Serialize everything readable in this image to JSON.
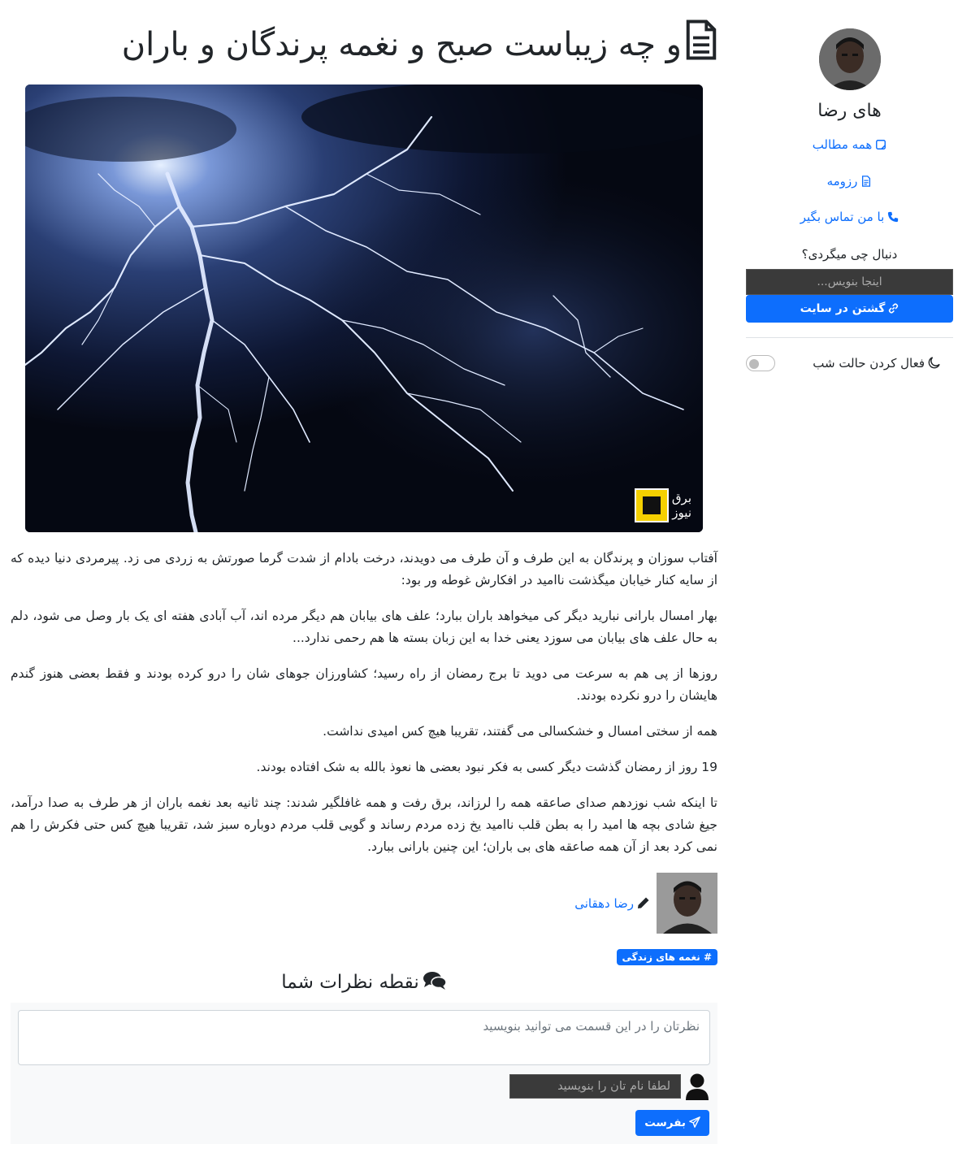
{
  "sidebar": {
    "site_name": "های رضا",
    "nav": [
      {
        "label": "همه مطالب",
        "icon": "bookmark-icon"
      },
      {
        "label": "رزومه",
        "icon": "document-icon"
      },
      {
        "label": "با من تماس بگیر",
        "icon": "phone-icon"
      }
    ],
    "search": {
      "label": "دنبال چی میگردی؟",
      "placeholder": "اینجا بنویس...",
      "button_label": "گشتن در سایت"
    },
    "dark_mode": {
      "label": "فعال کردن حالت شب",
      "enabled": false
    }
  },
  "post": {
    "title": "و چه زیباست صبح و نغمه پرندگان و باران",
    "image_logo_text": [
      "برق",
      "نیوز"
    ],
    "paragraphs": [
      "آفتاب سوزان و پرندگان به این طرف و آن طرف می دویدند، درخت بادام از شدت گرما صورتش به زردی می زد. پیرمردی دنیا دیده که از سایه کنار خیابان میگذشت ناامید در افکارش غوطه ور بود:",
      "بهار امسال بارانی نبارید دیگر کی میخواهد باران ببارد؛ علف های بیابان هم دیگر مرده اند، آب آبادی هفته ای یک بار وصل می شود، دلم به حال علف های بیابان می سوزد یعنی خدا به این زبان بسته ها هم رحمی ندارد...",
      "روزها از پی هم به سرعت می دوید تا برج رمضان از راه رسید؛ کشاورزان جوهای شان را درو کرده بودند و فقط بعضی هنوز گندم هایشان را درو نکرده بودند.",
      "همه از سختی امسال و خشکسالی می گفتند، تقریبا هیچ کس امیدی نداشت.",
      "19 روز از رمضان گذشت دیگر کسی به فکر نبود بعضی ها نعوذ بالله به شک افتاده بودند.",
      "تا اینکه شب نوزدهم صدای صاعقه همه را لرزاند، برق رفت و همه غافلگیر شدند: چند ثانیه بعد نغمه باران از هر طرف به صدا درآمد، جیغ شادی بچه ها امید را به بطن قلب ناامید یخ زده مردم رساند و گویی قلب مردم دوباره سبز شد، تقریبا هیچ کس حتی فکرش را هم نمی کرد بعد از آن همه صاعقه های بی باران؛ این چنین بارانی ببارد."
    ],
    "author": "رضا دهقانی",
    "tag": "# نغمه های زندگی"
  },
  "comments": {
    "title": "نقطه نظرات شما",
    "textarea_placeholder": "نظرتان را در این قسمت می توانید بنویسید",
    "name_placeholder": "لطفا نام تان را بنویسید",
    "send_label": "بفرست"
  },
  "colors": {
    "accent": "#0d6efd",
    "input_dark": "#3a3a3a"
  }
}
